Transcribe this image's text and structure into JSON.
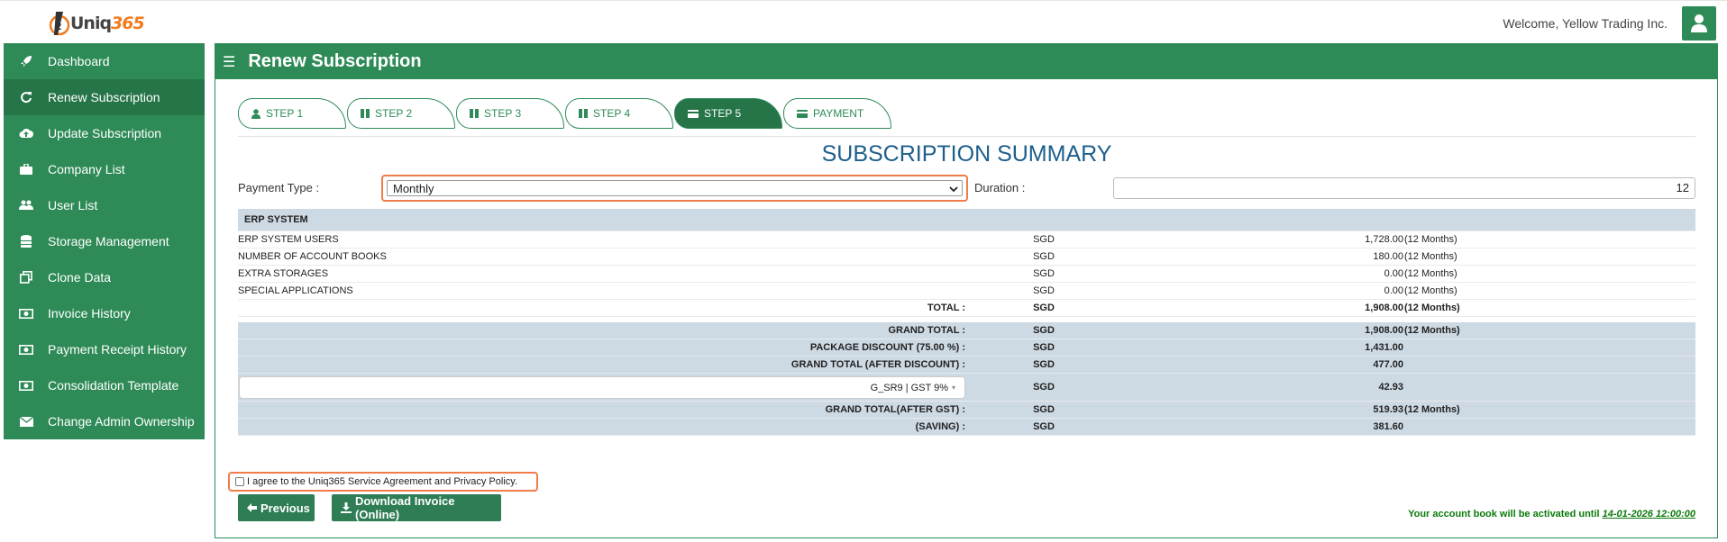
{
  "brand": {
    "logo_text_1": "Uniq",
    "logo_text_2": "365"
  },
  "header": {
    "welcome": "Welcome, Yellow Trading Inc."
  },
  "sidebar": {
    "items": [
      {
        "label": "Dashboard",
        "icon": "rocket-icon"
      },
      {
        "label": "Renew Subscription",
        "icon": "refresh-icon"
      },
      {
        "label": "Update Subscription",
        "icon": "cloud-upload-icon"
      },
      {
        "label": "Company List",
        "icon": "briefcase-icon"
      },
      {
        "label": "User List",
        "icon": "users-icon"
      },
      {
        "label": "Storage Management",
        "icon": "database-icon"
      },
      {
        "label": "Clone Data",
        "icon": "clone-icon"
      },
      {
        "label": "Invoice History",
        "icon": "money-icon"
      },
      {
        "label": "Payment Receipt History",
        "icon": "money-icon"
      },
      {
        "label": "Consolidation Template",
        "icon": "money-icon"
      },
      {
        "label": "Change Admin Ownership",
        "icon": "envelope-icon"
      }
    ],
    "active_index": 1
  },
  "panel": {
    "title": "Renew Subscription"
  },
  "steps": [
    {
      "label": "STEP 1",
      "icon": "user-icon"
    },
    {
      "label": "STEP 2",
      "icon": "columns-icon"
    },
    {
      "label": "STEP 3",
      "icon": "columns-icon"
    },
    {
      "label": "STEP 4",
      "icon": "columns-icon"
    },
    {
      "label": "STEP 5",
      "icon": "credit-card-icon"
    },
    {
      "label": "PAYMENT",
      "icon": "credit-card-icon"
    }
  ],
  "active_step": 4,
  "summary": {
    "title": "SUBSCRIPTION SUMMARY",
    "payment_type_label": "Payment Type :",
    "payment_type_value": "Monthly",
    "duration_label": "Duration :",
    "duration_value": "12",
    "section_header": "ERP SYSTEM",
    "items": [
      {
        "name": "ERP SYSTEM USERS",
        "currency": "SGD",
        "amount": "1,728.00",
        "duration": "(12 Months)"
      },
      {
        "name": "NUMBER OF ACCOUNT BOOKS",
        "currency": "SGD",
        "amount": "180.00",
        "duration": "(12 Months)"
      },
      {
        "name": "EXTRA STORAGES",
        "currency": "SGD",
        "amount": "0.00",
        "duration": "(12 Months)"
      },
      {
        "name": "SPECIAL APPLICATIONS",
        "currency": "SGD",
        "amount": "0.00",
        "duration": "(12 Months)"
      }
    ],
    "total": {
      "label": "TOTAL :",
      "currency": "SGD",
      "amount": "1,908.00",
      "duration": "(12 Months)"
    },
    "grand": [
      {
        "label": "GRAND TOTAL :",
        "currency": "SGD",
        "amount": "1,908.00",
        "duration": "(12 Months)"
      },
      {
        "label": "PACKAGE DISCOUNT (75.00 %) :",
        "currency": "SGD",
        "amount": "1,431.00",
        "duration": ""
      },
      {
        "label": "GRAND TOTAL (AFTER DISCOUNT) :",
        "currency": "SGD",
        "amount": "477.00",
        "duration": ""
      }
    ],
    "gst": {
      "select_value": "G_SR9 | GST 9%",
      "currency": "SGD",
      "amount": "42.93"
    },
    "after_gst": {
      "label": "GRAND TOTAL(AFTER GST) :",
      "currency": "SGD",
      "amount": "519.93",
      "duration": "(12 Months)"
    },
    "saving": {
      "label": "(SAVING) :",
      "currency": "SGD",
      "amount": "381.60"
    }
  },
  "agreement": {
    "text": "I agree to the Uniq365 Service Agreement and Privacy Policy."
  },
  "buttons": {
    "previous": "Previous",
    "download": "Download Invoice (Online)"
  },
  "activation": {
    "text": "Your account book will be activated until",
    "date": "14-01-2026 12:00:00"
  },
  "colors": {
    "primary": "#2e8b57",
    "primary_dark": "#267549",
    "accent": "#f07c4a",
    "title": "#1e5f8c",
    "row_shade": "#cdd9e3"
  }
}
